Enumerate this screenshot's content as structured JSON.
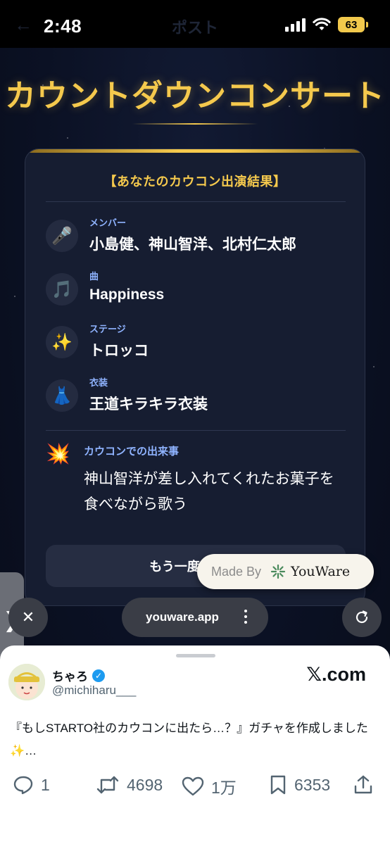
{
  "status_bar": {
    "time": "2:48",
    "battery": "63",
    "background_title": "ポスト"
  },
  "page": {
    "title": "カウントダウンコンサート",
    "accent_color": "#f5c94d"
  },
  "card": {
    "heading": "【あなたのカウコン出演結果】",
    "rows": [
      {
        "icon": "microphone-icon",
        "emoji": "🎤",
        "label": "メンバー",
        "value": "小島健、神山智洋、北村仁太郎"
      },
      {
        "icon": "music-notes-icon",
        "emoji": "🎵",
        "label": "曲",
        "value": "Happiness"
      },
      {
        "icon": "sparkles-icon",
        "emoji": "✨",
        "label": "ステージ",
        "value": "トロッコ"
      },
      {
        "icon": "dress-icon",
        "emoji": "👗",
        "label": "衣装",
        "value": "王道キラキラ衣装"
      }
    ],
    "event": {
      "icon": "collision-icon",
      "emoji": "💥",
      "label": "カウコンでの出来事",
      "line1": "神山智洋が差し入れてくれたお菓子を",
      "line2": "食べながら歌う"
    },
    "retry_label": "もう一度"
  },
  "made_by": {
    "prefix": "Made By",
    "brand": "YouWare"
  },
  "browser": {
    "url": "youware.app"
  },
  "tweet": {
    "display_name": "ちゃろ",
    "handle": "@michiharu___",
    "source": "𝕏.com",
    "text": "『もしSTARTO社のカウコンに出たら…？』ガチャを作成しました✨…",
    "replies": "1",
    "reposts": "4698",
    "likes": "1万",
    "bookmarks": "6353"
  }
}
